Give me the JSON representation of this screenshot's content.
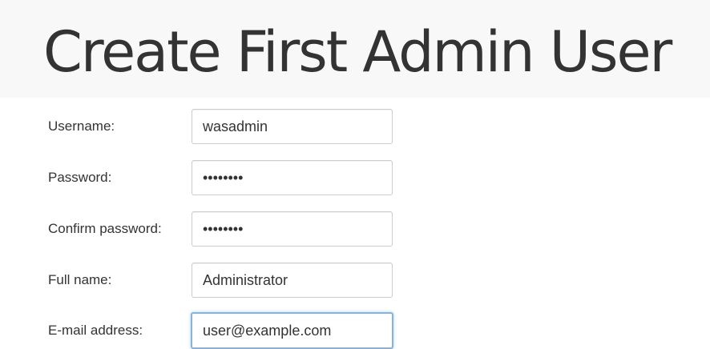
{
  "page": {
    "title": "Create First Admin User"
  },
  "form": {
    "username": {
      "label": "Username:",
      "value": "wasadmin"
    },
    "password": {
      "label": "Password:",
      "value": "password"
    },
    "confirm_password": {
      "label": "Confirm password:",
      "value": "password"
    },
    "full_name": {
      "label": "Full name:",
      "value": "Administrator"
    },
    "email": {
      "label": "E-mail address:",
      "value": "user@example.com"
    }
  },
  "colors": {
    "focus_border": "#86b2dc",
    "text": "#333333",
    "input_border": "#cccccc"
  }
}
